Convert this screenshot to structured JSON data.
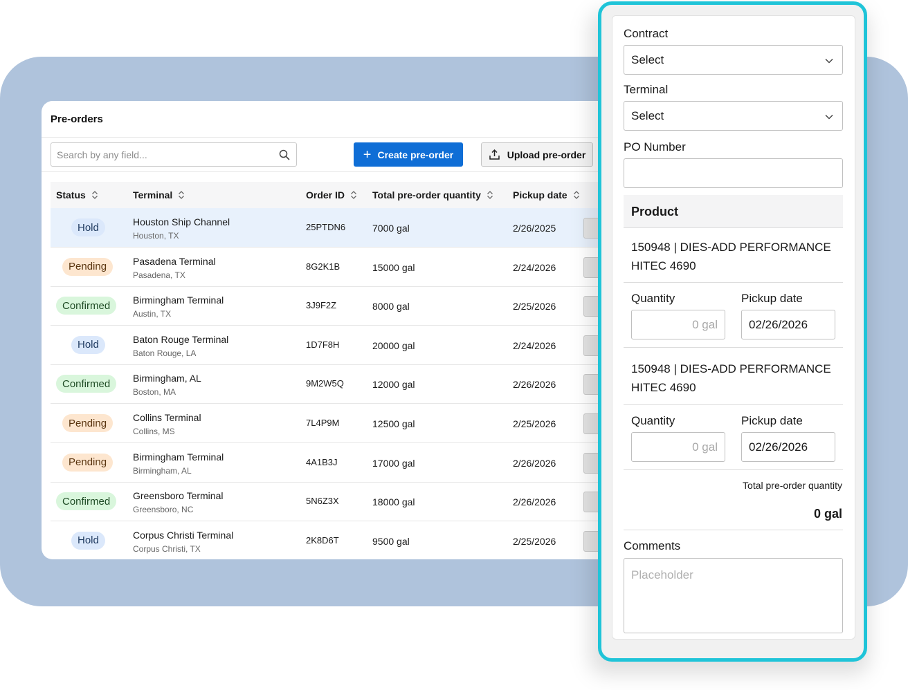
{
  "preorders": {
    "title": "Pre-orders",
    "search_placeholder": "Search by any field...",
    "create_button": "Create pre-order",
    "upload_button": "Upload pre-order",
    "columns": [
      "Status",
      "Terminal",
      "Order ID",
      "Total pre-order quantity",
      "Pickup date"
    ],
    "rows": [
      {
        "status": "Hold",
        "terminal": "Houston Ship Channel",
        "location": "Houston, TX",
        "order_id": "25PTDN6",
        "quantity": "7000 gal",
        "pickup": "2/26/2025"
      },
      {
        "status": "Pending",
        "terminal": "Pasadena Terminal",
        "location": "Pasadena, TX",
        "order_id": "8G2K1B",
        "quantity": "15000 gal",
        "pickup": "2/24/2026"
      },
      {
        "status": "Confirmed",
        "terminal": "Birmingham Terminal",
        "location": "Austin, TX",
        "order_id": "3J9F2Z",
        "quantity": "8000 gal",
        "pickup": "2/25/2026"
      },
      {
        "status": "Hold",
        "terminal": "Baton Rouge Terminal",
        "location": "Baton Rouge, LA",
        "order_id": "1D7F8H",
        "quantity": "20000 gal",
        "pickup": "2/24/2026"
      },
      {
        "status": "Confirmed",
        "terminal": "Birmingham, AL",
        "location": "Boston, MA",
        "order_id": "9M2W5Q",
        "quantity": "12000 gal",
        "pickup": "2/26/2026"
      },
      {
        "status": "Pending",
        "terminal": "Collins Terminal",
        "location": " Collins, MS",
        "order_id": "7L4P9M",
        "quantity": "12500 gal",
        "pickup": "2/25/2026"
      },
      {
        "status": "Pending",
        "terminal": "Birmingham Terminal",
        "location": "Birmingham, AL",
        "order_id": "4A1B3J",
        "quantity": "17000 gal",
        "pickup": "2/26/2026"
      },
      {
        "status": "Confirmed",
        "terminal": "Greensboro Terminal",
        "location": "Greensboro, NC",
        "order_id": "5N6Z3X",
        "quantity": "18000 gal",
        "pickup": "2/26/2026"
      },
      {
        "status": "Hold",
        "terminal": "Corpus Christi Terminal",
        "location": "Corpus Christi, TX",
        "order_id": "2K8D6T",
        "quantity": "9500 gal",
        "pickup": "2/25/2026"
      }
    ]
  },
  "form": {
    "contract_label": "Contract",
    "contract_value": "Select",
    "terminal_label": "Terminal",
    "terminal_value": "Select",
    "po_label": "PO Number",
    "po_value": "",
    "product_header": "Product",
    "products": [
      {
        "name": "150948 | DIES-ADD PERFORMANCE HITEC 4690",
        "quantity_label": "Quantity",
        "quantity_placeholder": "0 gal",
        "pickup_label": "Pickup date",
        "pickup_value": "02/26/2026"
      },
      {
        "name": "150948 | DIES-ADD PERFORMANCE HITEC 4690",
        "quantity_label": "Quantity",
        "quantity_placeholder": "0 gal",
        "pickup_label": "Pickup date",
        "pickup_value": "02/26/2026"
      }
    ],
    "total_label": "Total pre-order quantity",
    "total_value": "0 gal",
    "comments_label": "Comments",
    "comments_placeholder": "Placeholder"
  },
  "colors": {
    "accent": "#0f6ed6",
    "panel_border": "#1fc4d8",
    "background_band": "#afc3dc",
    "hold": "#dbe8fb",
    "pending": "#fde6cf",
    "confirmed": "#d9f6dc"
  },
  "icons": {
    "search": "search-icon",
    "plus": "plus-icon",
    "upload": "upload-icon",
    "sort": "sort-icon",
    "chevron": "chevron-down-icon",
    "edit": "edit-icon"
  }
}
